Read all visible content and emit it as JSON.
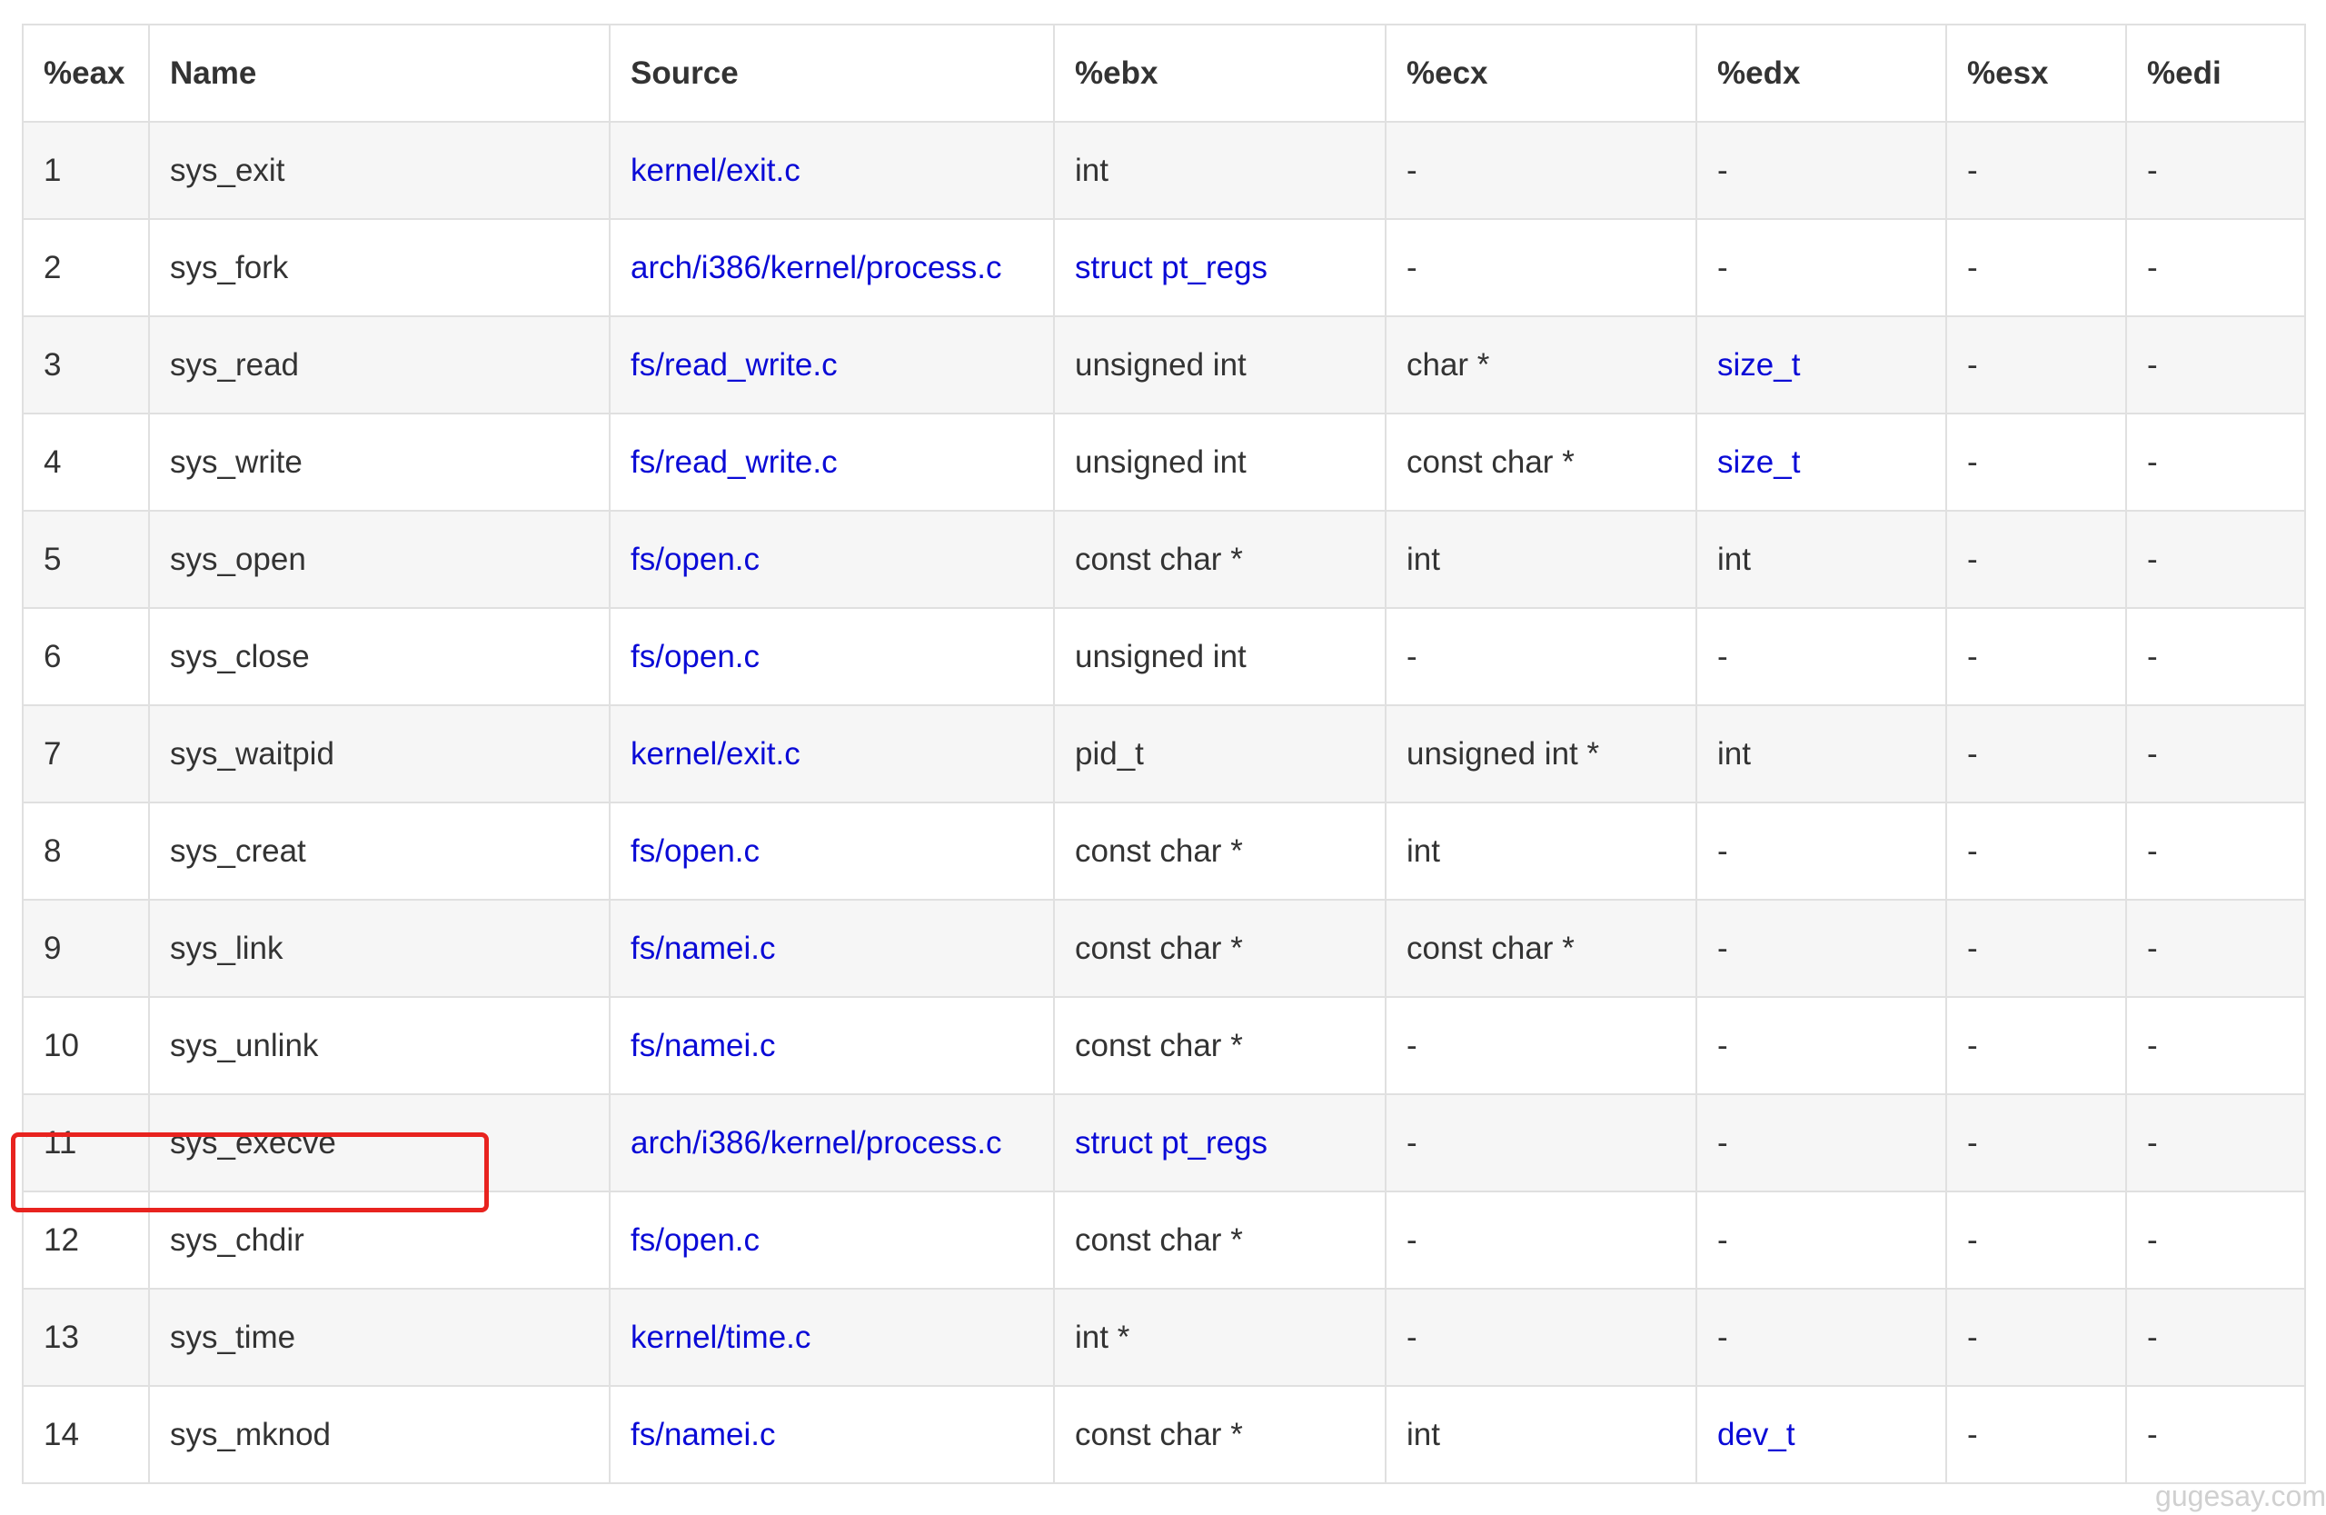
{
  "columns": [
    "%eax",
    "Name",
    "Source",
    "%ebx",
    "%ecx",
    "%edx",
    "%esx",
    "%edi"
  ],
  "rows": [
    {
      "eax": "1",
      "name": "sys_exit",
      "source": "kernel/exit.c",
      "ebx": "int",
      "ecx": "-",
      "edx": "-",
      "esx": "-",
      "edi": "-"
    },
    {
      "eax": "2",
      "name": "sys_fork",
      "source": "arch/i386/kernel/process.c",
      "ebx": "struct pt_regs",
      "ecx": "-",
      "edx": "-",
      "esx": "-",
      "edi": "-"
    },
    {
      "eax": "3",
      "name": "sys_read",
      "source": "fs/read_write.c",
      "ebx": "unsigned int",
      "ecx": "char *",
      "edx": "size_t",
      "esx": "-",
      "edi": "-"
    },
    {
      "eax": "4",
      "name": "sys_write",
      "source": "fs/read_write.c",
      "ebx": "unsigned int",
      "ecx": "const char *",
      "edx": "size_t",
      "esx": "-",
      "edi": "-"
    },
    {
      "eax": "5",
      "name": "sys_open",
      "source": "fs/open.c",
      "ebx": "const char *",
      "ecx": "int",
      "edx": "int",
      "esx": "-",
      "edi": "-"
    },
    {
      "eax": "6",
      "name": "sys_close",
      "source": "fs/open.c",
      "ebx": "unsigned int",
      "ecx": "-",
      "edx": "-",
      "esx": "-",
      "edi": "-"
    },
    {
      "eax": "7",
      "name": "sys_waitpid",
      "source": "kernel/exit.c",
      "ebx": "pid_t",
      "ecx": "unsigned int *",
      "edx": "int",
      "esx": "-",
      "edi": "-"
    },
    {
      "eax": "8",
      "name": "sys_creat",
      "source": "fs/open.c",
      "ebx": "const char *",
      "ecx": "int",
      "edx": "-",
      "esx": "-",
      "edi": "-"
    },
    {
      "eax": "9",
      "name": "sys_link",
      "source": "fs/namei.c",
      "ebx": "const char *",
      "ecx": "const char *",
      "edx": "-",
      "esx": "-",
      "edi": "-"
    },
    {
      "eax": "10",
      "name": "sys_unlink",
      "source": "fs/namei.c",
      "ebx": "const char *",
      "ecx": "-",
      "edx": "-",
      "esx": "-",
      "edi": "-"
    },
    {
      "eax": "11",
      "name": "sys_execve",
      "source": "arch/i386/kernel/process.c",
      "ebx": "struct pt_regs",
      "ecx": "-",
      "edx": "-",
      "esx": "-",
      "edi": "-"
    },
    {
      "eax": "12",
      "name": "sys_chdir",
      "source": "fs/open.c",
      "ebx": "const char *",
      "ecx": "-",
      "edx": "-",
      "esx": "-",
      "edi": "-"
    },
    {
      "eax": "13",
      "name": "sys_time",
      "source": "kernel/time.c",
      "ebx": "int *",
      "ecx": "-",
      "edx": "-",
      "esx": "-",
      "edi": "-"
    },
    {
      "eax": "14",
      "name": "sys_mknod",
      "source": "fs/namei.c",
      "ebx": "const char *",
      "ecx": "int",
      "edx": "dev_t",
      "esx": "-",
      "edi": "-"
    }
  ],
  "watermark": "gugesay.com",
  "colors": {
    "link": "#0a0ad6",
    "text": "#333333",
    "highlight": "#e8231f",
    "row_alt": "#f6f6f6",
    "border": "#e0e0e0"
  }
}
